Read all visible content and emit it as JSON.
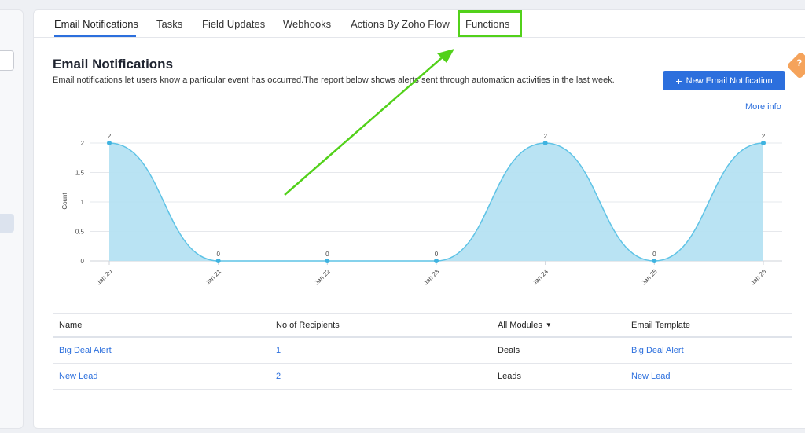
{
  "tabs": [
    {
      "label": "Email Notifications"
    },
    {
      "label": "Tasks"
    },
    {
      "label": "Field Updates"
    },
    {
      "label": "Webhooks"
    },
    {
      "label": "Actions By Zoho Flow"
    },
    {
      "label": "Functions"
    }
  ],
  "header": {
    "title": "Email Notifications",
    "description": "Email notifications let users know a particular event has occurred.The report below shows alerts sent through automation activities in the last week.",
    "new_button_label": "New Email Notification",
    "more_info": "More info",
    "help_glyph": "?"
  },
  "chart_data": {
    "type": "area",
    "categories": [
      "Jan 20",
      "Jan 21",
      "Jan 22",
      "Jan 23",
      "Jan 24",
      "Jan 25",
      "Jan 26"
    ],
    "values": [
      2,
      0,
      0,
      0,
      2,
      0,
      2
    ],
    "data_labels": [
      "2",
      "0",
      "0",
      "0",
      "2",
      "0",
      "2"
    ],
    "ylabel": "Count",
    "xlabel": "",
    "ylim": [
      0,
      2
    ],
    "yticks": [
      "0",
      "0.5",
      "1",
      "1.5",
      "2"
    ],
    "grid": true,
    "colors": {
      "fill": "#b5e2f2",
      "line": "#5ec3e6",
      "point": "#3fb3e0"
    }
  },
  "table": {
    "headers": [
      "Name",
      "No of Recipients",
      "All Modules",
      "Email Template"
    ],
    "rows": [
      {
        "name": "Big Deal Alert",
        "recipients": "1",
        "module": "Deals",
        "template": "Big Deal Alert"
      },
      {
        "name": "New Lead",
        "recipients": "2",
        "module": "Leads",
        "template": "New Lead"
      }
    ]
  },
  "colors": {
    "accent": "#2c6fdd",
    "highlight": "#52d11a"
  }
}
